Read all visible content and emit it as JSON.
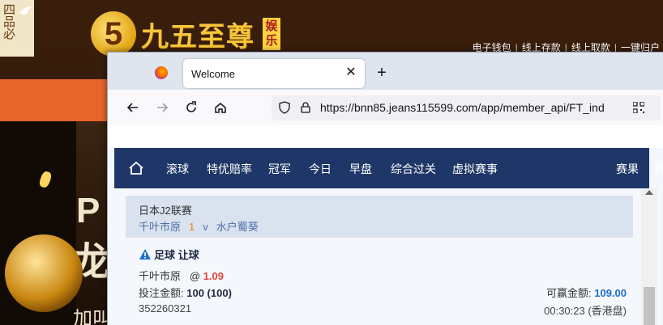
{
  "background_site": {
    "left_banner_chars": "四品必",
    "logo_mark": "5",
    "logo_text": "九五至尊",
    "logo_badge": "娱乐",
    "top_links": [
      "电子钱包",
      "线上存款",
      "线上取款",
      "一键归户"
    ],
    "poster_big_char_1": "P",
    "poster_big_char_2": "龙",
    "poster_big_char_3": "加叫"
  },
  "browser": {
    "tab": {
      "title": "Welcome",
      "close_glyph": "✕"
    },
    "new_tab_glyph": "+",
    "url": "https://bnn85.jeans115599.com/app/member_api/FT_ind"
  },
  "site_nav": {
    "items": [
      "滚球",
      "特优赔率",
      "冠军",
      "今日",
      "早盘",
      "综合过关",
      "虚拟赛事",
      "赛果",
      "赛"
    ]
  },
  "bet": {
    "league": "日本J2联赛",
    "home_team": "千叶市原",
    "score": "1",
    "vs": "v",
    "away_team": "水户蜀葵",
    "bet_type": "足球 让球",
    "selection_team": "千叶市原",
    "odds_prefix": "@",
    "odds": "1.09",
    "stake_label": "投注金额:",
    "stake_value": "100 (100)",
    "ticket_id": "352260321",
    "win_label": "可赢金额:",
    "win_value": "109.00",
    "time": "00:30:23 (香港盘)"
  },
  "colors": {
    "nav_bg": "#1f3768",
    "odds": "#e0443a",
    "win_amount": "#1b6fd0",
    "score": "#e87a1d"
  }
}
